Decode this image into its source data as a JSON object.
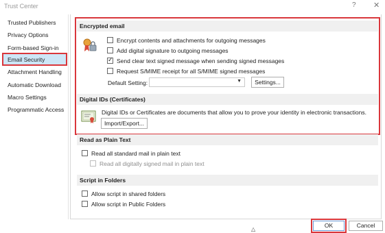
{
  "window": {
    "title": "Trust Center",
    "help": "?",
    "close": "✕"
  },
  "sidebar": {
    "items": [
      {
        "label": "Trusted Publishers"
      },
      {
        "label": "Privacy Options"
      },
      {
        "label": "Form-based Sign-in"
      },
      {
        "label": "Email Security",
        "selected": true
      },
      {
        "label": "Attachment Handling"
      },
      {
        "label": "Automatic Download"
      },
      {
        "label": "Macro Settings"
      },
      {
        "label": "Programmatic Access"
      }
    ]
  },
  "encrypted_email": {
    "heading": "Encrypted email",
    "options": [
      {
        "label": "Encrypt contents and attachments for outgoing messages",
        "checked": false
      },
      {
        "label": "Add digital signature to outgoing messages",
        "checked": false
      },
      {
        "label": "Send clear text signed message when sending signed messages",
        "checked": true
      },
      {
        "label": "Request S/MIME receipt for all S/MIME signed messages",
        "checked": false
      }
    ],
    "default_setting_label": "Default Setting:",
    "default_setting_value": "",
    "settings_button": "Settings..."
  },
  "digital_ids": {
    "heading": "Digital IDs (Certificates)",
    "description": "Digital IDs or Certificates are documents that allow you to prove your identity in electronic transactions.",
    "import_export_button": "Import/Export..."
  },
  "read_plain_text": {
    "heading": "Read as Plain Text",
    "options": [
      {
        "label": "Read all standard mail in plain text",
        "checked": false,
        "disabled": false
      },
      {
        "label": "Read all digitally signed mail in plain text",
        "checked": false,
        "disabled": true
      }
    ]
  },
  "script_folders": {
    "heading": "Script in Folders",
    "options": [
      {
        "label": "Allow script in shared folders",
        "checked": false
      },
      {
        "label": "Allow script in Public Folders",
        "checked": false
      }
    ]
  },
  "footer": {
    "ok_button": "OK",
    "cancel_button": "Cancel"
  },
  "colors": {
    "highlight": "#d9363b",
    "selected_item": "#cde6f7",
    "section_bg": "#f0f0f0"
  }
}
